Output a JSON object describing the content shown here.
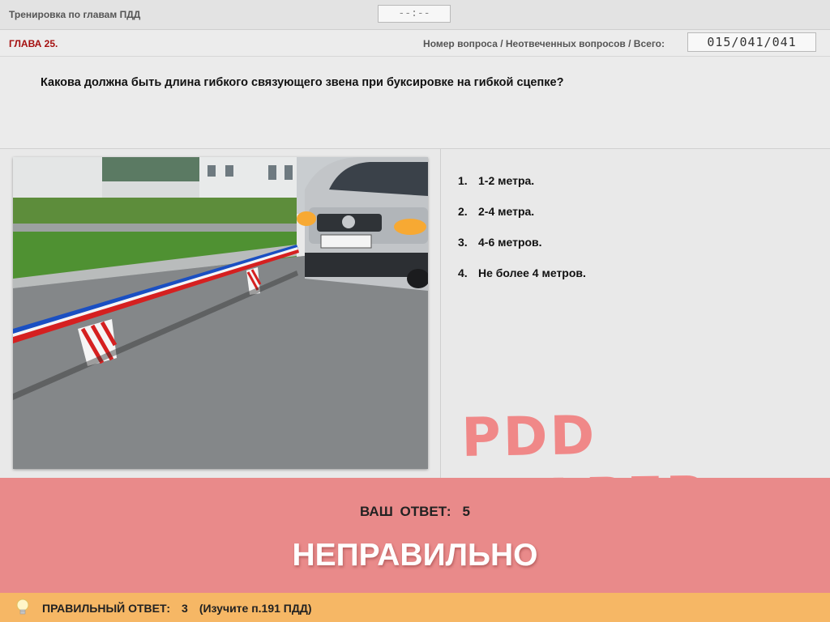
{
  "app": {
    "title": "Тренировка по главам ПДД",
    "timer": "--:--"
  },
  "chapter": {
    "label": "ГЛАВА 25.",
    "counter_label": "Номер вопроса / Неотвеченных вопросов / Всего:",
    "counter_value": "015/041/041"
  },
  "question": {
    "text": "Какова должна быть длина гибкого связующего звена при буксировке на гибкой сцепке?",
    "image_icon": "car-towing-photo"
  },
  "answers": [
    {
      "num": "1.",
      "text": "1-2 метра."
    },
    {
      "num": "2.",
      "text": "2-4 метра."
    },
    {
      "num": "3.",
      "text": "4-6 метров."
    },
    {
      "num": "4.",
      "text": "Не более 4 метров."
    }
  ],
  "watermark": "PDD HELPER",
  "result": {
    "your_answer_label": "ВАШ ОТВЕТ:",
    "your_answer_value": "5",
    "verdict": "НЕПРАВИЛЬНО",
    "color": "#e98a8a"
  },
  "correct": {
    "label": "ПРАВИЛЬНЫЙ ОТВЕТ:",
    "value": "3",
    "hint": "(Изучите п.191 ПДД)",
    "icon": "lightbulb-icon",
    "color": "#f6b765"
  }
}
